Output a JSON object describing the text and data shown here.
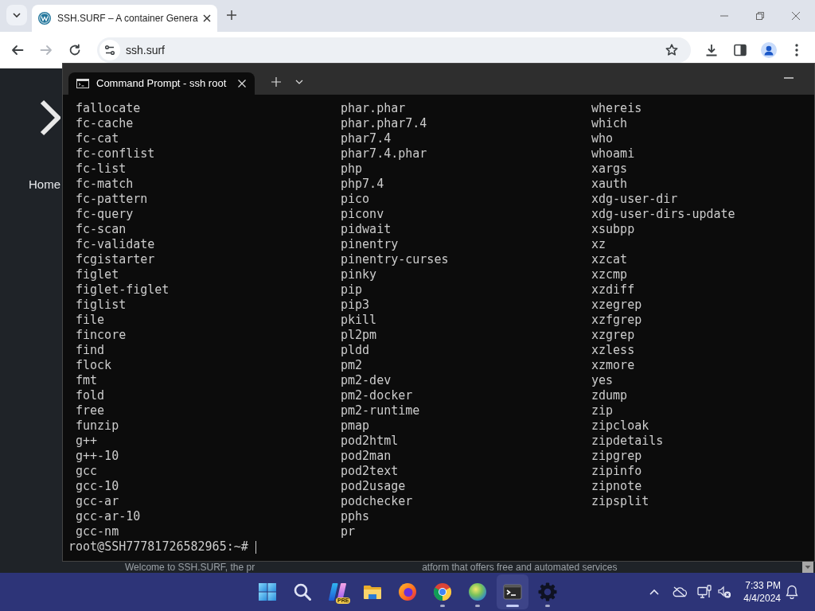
{
  "browser": {
    "tabs": [
      {
        "title": "SSH.SURF – A container Genera",
        "selected": true
      }
    ],
    "nav": [
      {
        "kind": "back",
        "disabled": false
      },
      {
        "kind": "forward",
        "disabled": true
      },
      {
        "kind": "reload",
        "disabled": false
      }
    ],
    "url": "ssh.surf"
  },
  "page": {
    "nav_label": "Home",
    "welcome_text": [
      "Welcome to SSH.SURF, the pr",
      "atform that offers free and automated services"
    ]
  },
  "terminal": {
    "tabs": [
      {
        "title": "Command Prompt - ssh root",
        "selected": true
      }
    ],
    "columns": [
      [
        "fallocate",
        "fc-cache",
        "fc-cat",
        "fc-conflist",
        "fc-list",
        "fc-match",
        "fc-pattern",
        "fc-query",
        "fc-scan",
        "fc-validate",
        "fcgistarter",
        "figlet",
        "figlet-figlet",
        "figlist",
        "file",
        "fincore",
        "find",
        "flock",
        "fmt",
        "fold",
        "free",
        "funzip",
        "g++",
        "g++-10",
        "gcc",
        "gcc-10",
        "gcc-ar",
        "gcc-ar-10",
        "gcc-nm"
      ],
      [
        "phar.phar",
        "phar.phar7.4",
        "phar7.4",
        "phar7.4.phar",
        "php",
        "php7.4",
        "pico",
        "piconv",
        "pidwait",
        "pinentry",
        "pinentry-curses",
        "pinky",
        "pip",
        "pip3",
        "pkill",
        "pl2pm",
        "pldd",
        "pm2",
        "pm2-dev",
        "pm2-docker",
        "pm2-runtime",
        "pmap",
        "pod2html",
        "pod2man",
        "pod2text",
        "pod2usage",
        "podchecker",
        "pphs",
        "pr"
      ],
      [
        "whereis",
        "which",
        "who",
        "whoami",
        "xargs",
        "xauth",
        "xdg-user-dir",
        "xdg-user-dirs-update",
        "xsubpp",
        "xz",
        "xzcat",
        "xzcmp",
        "xzdiff",
        "xzegrep",
        "xzfgrep",
        "xzgrep",
        "xzless",
        "xzmore",
        "yes",
        "zdump",
        "zip",
        "zipcloak",
        "zipdetails",
        "zipgrep",
        "zipinfo",
        "zipnote",
        "zipsplit"
      ]
    ],
    "prompt": "root@SSH77781726582965:~#"
  },
  "taskbar": {
    "apps": [
      {
        "kind": "start",
        "running": false,
        "active": false
      },
      {
        "kind": "search",
        "running": false,
        "active": false
      },
      {
        "kind": "copilot",
        "badge": "PRE",
        "running": false,
        "active": false
      },
      {
        "kind": "files",
        "running": false,
        "active": false
      },
      {
        "kind": "firefox",
        "running": false,
        "active": false
      },
      {
        "kind": "chrome",
        "running": true,
        "active": false
      },
      {
        "kind": "edge",
        "running": true,
        "active": false
      },
      {
        "kind": "terminal",
        "running": true,
        "active": true
      },
      {
        "kind": "settings",
        "running": true,
        "active": false
      }
    ],
    "sound_muted": true,
    "time": "7:33 PM",
    "date": "4/4/2024"
  }
}
